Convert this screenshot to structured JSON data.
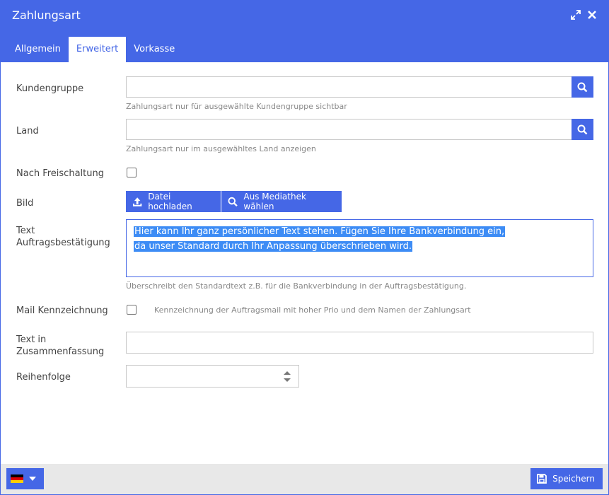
{
  "window": {
    "title": "Zahlungsart"
  },
  "tabs": [
    {
      "label": "Allgemein",
      "active": false
    },
    {
      "label": "Erweitert",
      "active": true
    },
    {
      "label": "Vorkasse",
      "active": false
    }
  ],
  "form": {
    "kundengruppe": {
      "label": "Kundengruppe",
      "value": "",
      "help": "Zahlungsart nur für ausgewählte Kundengruppe sichtbar"
    },
    "land": {
      "label": "Land",
      "value": "",
      "help": "Zahlungsart nur im ausgewähltes Land anzeigen"
    },
    "freischaltung": {
      "label": "Nach Freischaltung",
      "checked": false
    },
    "bild": {
      "label": "Bild",
      "upload_label": "Datei hochladen",
      "media_label": "Aus Mediathek wählen"
    },
    "text_bestaetigung": {
      "label_line1": "Text",
      "label_line2": "Auftragsbestätigung",
      "line1": "Hier kann Ihr ganz persönlicher Text stehen. Fügen Sie Ihre Bankverbindung ein,",
      "line2": "da unser Standard durch Ihr Anpassung überschrieben wird.",
      "help": "Überschreibt den Standardtext z.B. für die Bankverbindung in der Auftragsbestätigung."
    },
    "mail_kennzeichnung": {
      "label": "Mail Kennzeichnung",
      "checked": false,
      "description": "Kennzeichnung der Auftragsmail mit hoher Prio und dem Namen der Zahlungsart"
    },
    "text_zusammenfassung": {
      "label_line1": "Text in",
      "label_line2": "Zusammenfassung",
      "value": ""
    },
    "reihenfolge": {
      "label": "Reihenfolge",
      "value": ""
    }
  },
  "footer": {
    "save_label": "Speichern",
    "language": "de"
  },
  "colors": {
    "accent": "#4567e6",
    "selection": "#3d8cf5",
    "footer_bg": "#e8e8e8"
  }
}
